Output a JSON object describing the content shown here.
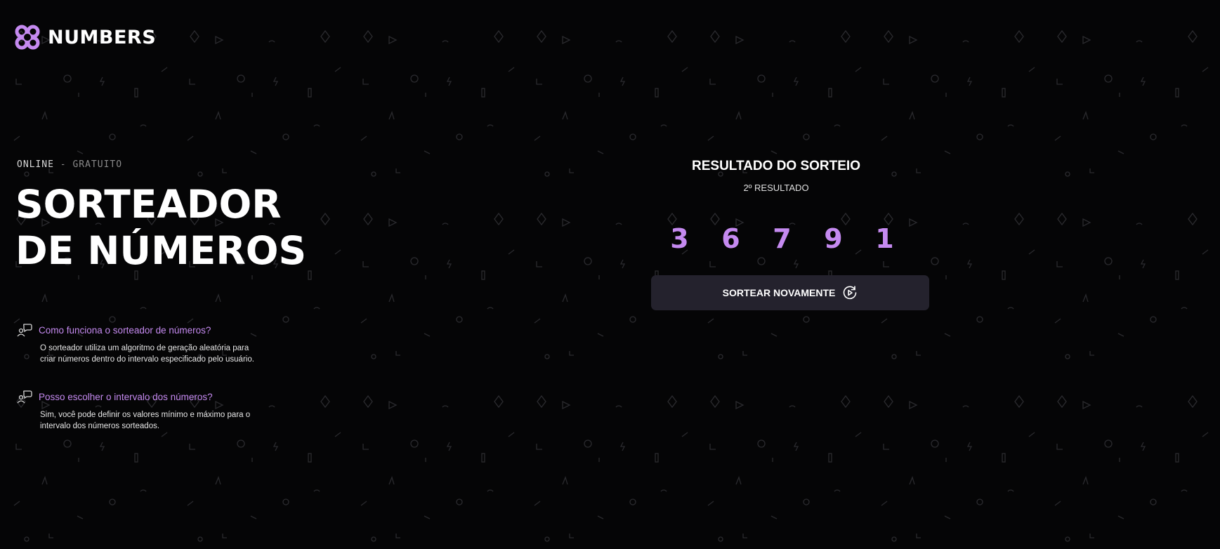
{
  "brand": {
    "name": "NUMBERS",
    "accent": "#c58af0",
    "icon": "clover-logo-icon"
  },
  "hero": {
    "eyebrow_primary": "ONLINE",
    "eyebrow_separator": "-",
    "eyebrow_secondary": "GRATUITO",
    "title_line1": "SORTEADOR",
    "title_line2": "DE NÚMEROS"
  },
  "faq": [
    {
      "icon": "chat-people-icon",
      "question": "Como funciona o sorteador de números?",
      "answer": "O sorteador utiliza um algoritmo de geração aleatória para criar números dentro do intervalo especificado pelo usuário."
    },
    {
      "icon": "chat-people-icon",
      "question": "Posso escolher o intervalo dos números?",
      "answer": "Sim, você pode definir os valores mínimo e máximo para o intervalo dos números sorteados."
    }
  ],
  "result": {
    "title": "RESULTADO DO SORTEIO",
    "subtitle": "2º RESULTADO",
    "numbers": [
      "3",
      "6",
      "7",
      "9",
      "1"
    ],
    "button_label": "SORTEAR NOVAMENTE",
    "button_icon": "redo-icon"
  },
  "colors": {
    "background": "#050506",
    "button_bg": "#24222d",
    "accent": "#c58af0"
  }
}
